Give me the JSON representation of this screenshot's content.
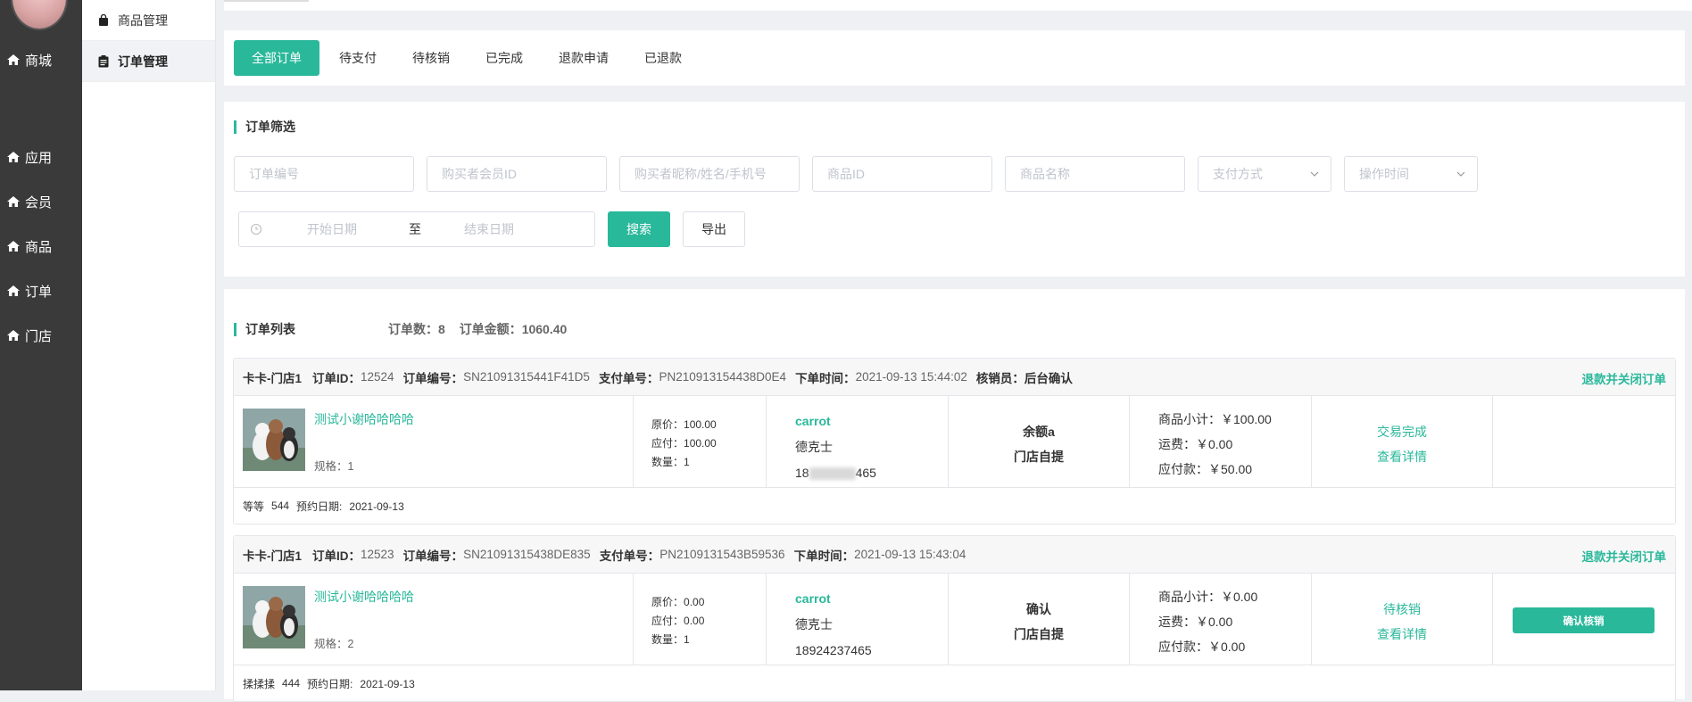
{
  "nav": {
    "items": [
      {
        "label": "商城",
        "icon": "home-icon"
      },
      {
        "label": "应用",
        "icon": "home-icon"
      },
      {
        "label": "会员",
        "icon": "home-icon"
      },
      {
        "label": "商品",
        "icon": "home-icon"
      },
      {
        "label": "订单",
        "icon": "home-icon"
      },
      {
        "label": "门店",
        "icon": "home-icon"
      }
    ]
  },
  "submenu": {
    "items": [
      {
        "label": "商品管理",
        "icon": "bag-icon",
        "active": false
      },
      {
        "label": "订单管理",
        "icon": "clipboard-icon",
        "active": true
      }
    ]
  },
  "tabs": [
    {
      "label": "全部订单",
      "active": true
    },
    {
      "label": "待支付"
    },
    {
      "label": "待核销"
    },
    {
      "label": "已完成"
    },
    {
      "label": "退款申请"
    },
    {
      "label": "已退款"
    }
  ],
  "filter": {
    "title": "订单筛选",
    "order_no_placeholder": "订单编号",
    "member_id_placeholder": "购买者会员ID",
    "buyer_placeholder": "购买者昵称/姓名/手机号",
    "goods_id_placeholder": "商品ID",
    "goods_name_placeholder": "商品名称",
    "pay_method_placeholder": "支付方式",
    "op_time_placeholder": "操作时间",
    "start_date_placeholder": "开始日期",
    "range_sep": "至",
    "end_date_placeholder": "结束日期",
    "search_label": "搜索",
    "export_label": "导出"
  },
  "list": {
    "title": "订单列表",
    "count_label": "订单数：",
    "count_value": "8",
    "amount_label": "订单金额：",
    "amount_value": "1060.40"
  },
  "labels": {
    "order_id": "订单ID：",
    "order_no": "订单编号：",
    "pay_no": "支付单号：",
    "order_time": "下单时间：",
    "verifier": "核销员：",
    "orig_price": "原价：",
    "payable": "应付：",
    "qty": "数量：",
    "subtotal": "商品小计：",
    "freight": "运费：",
    "payable_amount": "应付款：",
    "spec": "规格：",
    "reserve_date": "预约日期:"
  },
  "orders": [
    {
      "store": "卡卡-门店1",
      "order_id": "12524",
      "order_no": "SN21091315441F41D5",
      "pay_no": "PN210913154438D0E4",
      "order_time": "2021-09-13 15:44:02",
      "verifier": "后台确认",
      "head_action": "退款并关闭订单",
      "product_name": "测试小谢哈哈哈哈",
      "spec": "1",
      "orig_price": "100.00",
      "payable": "100.00",
      "qty": "1",
      "buyer_nick": "carrot",
      "buyer_name": "德克士",
      "buyer_phone_pre": "18",
      "buyer_phone_post": "465",
      "pay_method": "余额a",
      "delivery": "门店自提",
      "subtotal": "￥100.00",
      "freight": "￥0.00",
      "payable_amount": "￥50.00",
      "status": "交易完成",
      "detail": "查看详情",
      "foot_name": "等等",
      "foot_code": "544",
      "reserve_date": "2021-09-13"
    },
    {
      "store": "卡卡-门店1",
      "order_id": "12523",
      "order_no": "SN21091315438DE835",
      "pay_no": "PN2109131543B59536",
      "order_time": "2021-09-13 15:43:04",
      "head_action": "退款并关闭订单",
      "product_name": "测试小谢哈哈哈哈",
      "spec": "2",
      "orig_price": "0.00",
      "payable": "0.00",
      "qty": "1",
      "buyer_nick": "carrot",
      "buyer_name": "德克士",
      "buyer_phone": "18924237465",
      "pay_method": "确认",
      "delivery": "门店自提",
      "subtotal": "￥0.00",
      "freight": "￥0.00",
      "payable_amount": "￥0.00",
      "status": "待核销",
      "detail": "查看详情",
      "confirm": "确认核销",
      "foot_name": "揉揉揉",
      "foot_code": "444",
      "reserve_date": "2021-09-13"
    }
  ],
  "colors": {
    "accent": "#2ab89b",
    "nav_bg": "#3a3a3a",
    "page_bg": "#eef0f3"
  }
}
